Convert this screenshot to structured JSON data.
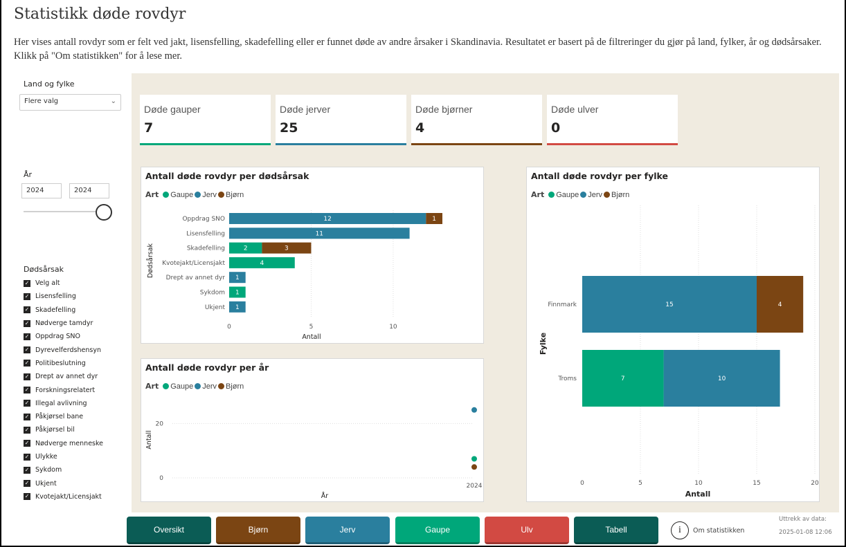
{
  "page": {
    "title": "Statistikk døde rovdyr",
    "description": "Her vises antall rovdyr som er felt ved jakt, lisensfelling, skadefelling eller er funnet døde av andre årsaker i Skandinavia. Resultatet er basert på de filtreringer du gjør på land, fylker, år og dødsårsaker. Klikk på \"Om statistikken\" for å lese mer."
  },
  "sidebar": {
    "land_label": "Land og fylke",
    "land_value": "Flere valg",
    "year_label": "År",
    "year_from": "2024",
    "year_to": "2024",
    "cause_label": "Dødsårsak",
    "causes": [
      "Velg alt",
      "Lisensfelling",
      "Skadefelling",
      "Nødverge tamdyr",
      "Oppdrag SNO",
      "Dyrevelferdshensyn",
      "Politibeslutning",
      "Drept av annet dyr",
      "Forskningsrelatert",
      "Illegal avlivning",
      "Påkjørsel bane",
      "Påkjørsel bil",
      "Nødverge menneske",
      "Ulykke",
      "Sykdom",
      "Ukjent",
      "Kvotejakt/Licensjakt"
    ],
    "checkmark": "✓"
  },
  "cards": [
    {
      "label": "Døde gauper",
      "value": "7",
      "color": "#00a77a"
    },
    {
      "label": "Døde jerver",
      "value": "25",
      "color": "#2a7f9e"
    },
    {
      "label": "Døde bjørner",
      "value": "4",
      "color": "#7b4513"
    },
    {
      "label": "Døde ulver",
      "value": "0",
      "color": "#d24a43"
    }
  ],
  "colors": {
    "gaupe": "#00a77a",
    "jerv": "#2a7f9e",
    "bjorn": "#7b4513",
    "ulv": "#d24a43"
  },
  "legend": {
    "title": "Art",
    "items": [
      "Gaupe",
      "Jerv",
      "Bjørn"
    ]
  },
  "chart_data": [
    {
      "type": "bar",
      "orientation": "horizontal",
      "stacked": true,
      "title": "Antall døde rovdyr per dødsårsak",
      "xlabel": "Antall",
      "ylabel": "Dødsårsak",
      "categories": [
        "Oppdrag SNO",
        "Lisensfelling",
        "Skadefelling",
        "Kvotejakt/Licensjakt",
        "Drept av annet dyr",
        "Sykdom",
        "Ukjent"
      ],
      "series": [
        {
          "name": "Gaupe",
          "values": [
            0,
            0,
            2,
            4,
            0,
            1,
            0
          ]
        },
        {
          "name": "Jerv",
          "values": [
            12,
            11,
            0,
            0,
            1,
            0,
            1
          ]
        },
        {
          "name": "Bjørn",
          "values": [
            1,
            0,
            3,
            0,
            0,
            0,
            0
          ]
        }
      ],
      "xlim": [
        0,
        13
      ],
      "xticks": [
        0,
        5,
        10
      ]
    },
    {
      "type": "scatter",
      "title": "Antall døde rovdyr per år",
      "xlabel": "År",
      "ylabel": "Antall",
      "categories": [
        "2024"
      ],
      "series": [
        {
          "name": "Gaupe",
          "values": [
            7
          ]
        },
        {
          "name": "Jerv",
          "values": [
            25
          ]
        },
        {
          "name": "Bjørn",
          "values": [
            4
          ]
        }
      ],
      "ylim": [
        0,
        28
      ],
      "yticks": [
        0,
        20
      ]
    },
    {
      "type": "bar",
      "orientation": "horizontal",
      "stacked": true,
      "title": "Antall døde rovdyr per fylke",
      "xlabel": "Antall",
      "ylabel": "Fylke",
      "categories": [
        "Finnmark",
        "Troms"
      ],
      "series": [
        {
          "name": "Gaupe",
          "values": [
            0,
            7
          ]
        },
        {
          "name": "Jerv",
          "values": [
            15,
            10
          ]
        },
        {
          "name": "Bjørn",
          "values": [
            4,
            0
          ]
        }
      ],
      "xlim": [
        0,
        20
      ],
      "xticks": [
        0,
        5,
        10,
        15,
        20
      ]
    }
  ],
  "nav_buttons": [
    {
      "label": "Oversikt",
      "color": "#0b5c55"
    },
    {
      "label": "Bjørn",
      "color": "#7b4513"
    },
    {
      "label": "Jerv",
      "color": "#2a7f9e"
    },
    {
      "label": "Gaupe",
      "color": "#00a77a"
    },
    {
      "label": "Ulv",
      "color": "#d24a43"
    },
    {
      "label": "Tabell",
      "color": "#0b5c55"
    }
  ],
  "info": {
    "glyph": "i",
    "label": "Om statistikken"
  },
  "extract": {
    "label": "Uttrekk av data:",
    "date": "2025-01-08 12:06"
  }
}
